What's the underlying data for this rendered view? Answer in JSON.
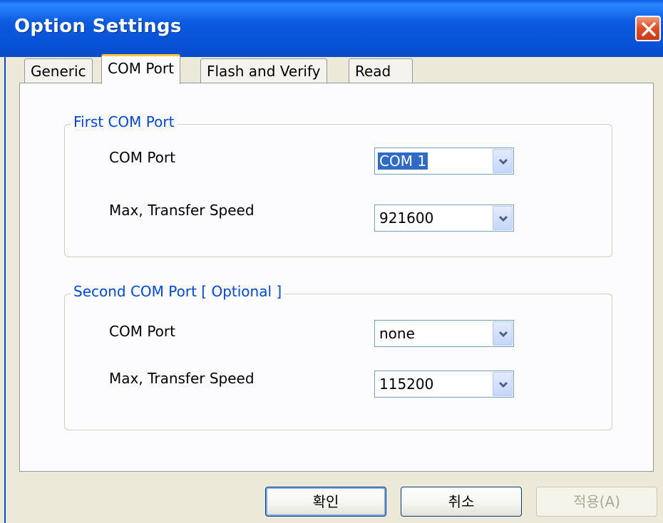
{
  "window": {
    "title": "Option Settings"
  },
  "tabs": [
    {
      "label": "Generic",
      "active": false
    },
    {
      "label": "COM Port",
      "active": true
    },
    {
      "label": "Flash and Verify",
      "active": false
    },
    {
      "label": "Read",
      "active": false
    }
  ],
  "first_group": {
    "legend": "First COM Port",
    "com_port_label": "COM Port",
    "com_port_value": "COM 1",
    "speed_label": "Max, Transfer Speed",
    "speed_value": "921600"
  },
  "second_group": {
    "legend": "Second COM Port [ Optional ]",
    "com_port_label": "COM Port",
    "com_port_value": "none",
    "speed_label": "Max, Transfer Speed",
    "speed_value": "115200"
  },
  "buttons": {
    "ok": "확인",
    "cancel": "취소",
    "apply": "적용(A)"
  },
  "colors": {
    "title_bar": "#0752d6",
    "group_legend": "#0046d5",
    "active_tab_highlight": "#ffc83c",
    "selection": "#316ac5"
  }
}
